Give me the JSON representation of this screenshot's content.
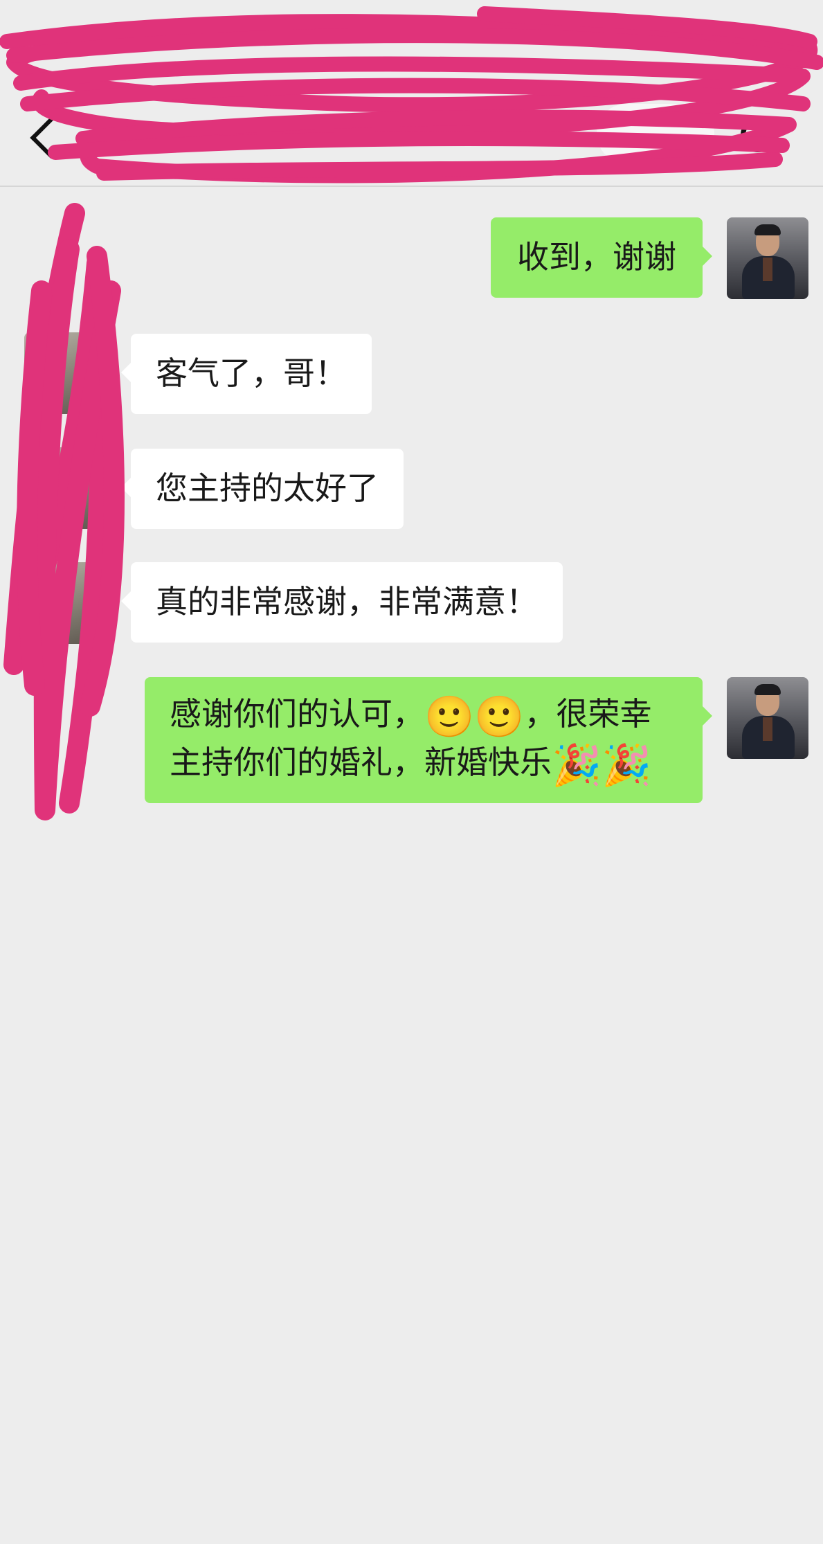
{
  "messages": [
    {
      "side": "right",
      "text": "收到，谢谢"
    },
    {
      "side": "left",
      "text": "客气了，哥！"
    },
    {
      "side": "left",
      "text": "您主持的太好了"
    },
    {
      "side": "left",
      "text": "真的非常感谢，非常满意！"
    },
    {
      "side": "right",
      "line1": "感谢你们的认可，",
      "emoji_smile": "🙂🙂",
      "line1_end": "，很荣幸",
      "line2": "主持你们的婚礼，新婚快乐",
      "emoji_party": "🎉🎉"
    }
  ],
  "icons": {
    "back": "chevron-left-icon",
    "more": "more-icon",
    "target": "target-icon"
  },
  "colors": {
    "background": "#ededed",
    "self_bubble": "#95ec69",
    "peer_bubble": "#ffffff",
    "redaction": "#e0337a"
  }
}
